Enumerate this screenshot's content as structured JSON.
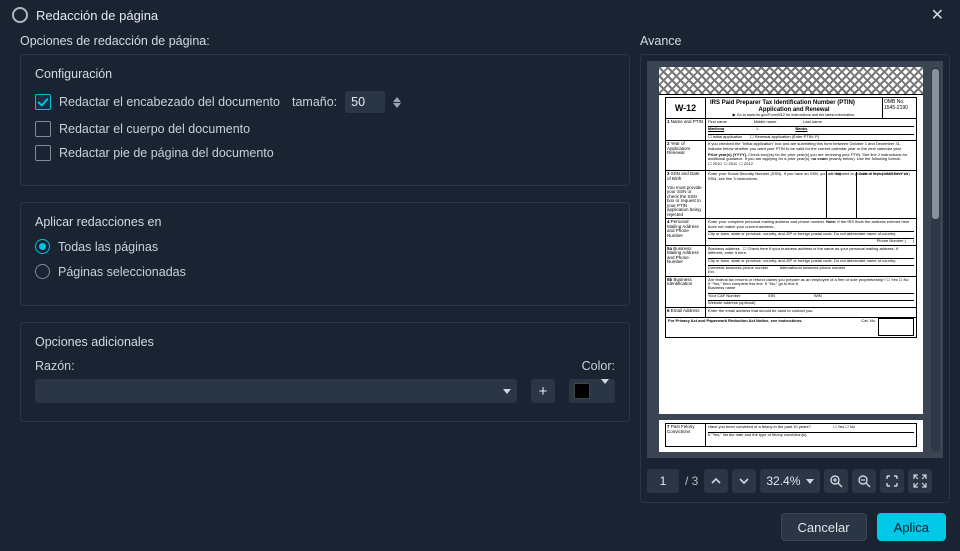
{
  "titlebar": {
    "title": "Redacción de página"
  },
  "left": {
    "heading": "Opciones de redacción de página:",
    "config": {
      "title": "Configuración",
      "header_redact_label": "Redactar el encabezado del documento",
      "size_label": "tamaño:",
      "size_value": "50",
      "body_redact_label": "Redactar el cuerpo del documento",
      "footer_redact_label": "Redactar pie de página del documento"
    },
    "apply": {
      "title": "Aplicar redacciones en",
      "all_pages": "Todas las páginas",
      "selected_pages": "Páginas seleccionadas"
    },
    "additional": {
      "title": "Opciones adicionales",
      "reason_label": "Razón:",
      "color_label": "Color:",
      "color_value": "#000000"
    }
  },
  "right": {
    "heading": "Avance",
    "doc": {
      "form_id": "W-12",
      "title_line1": "IRS Paid Preparer Tax Identification Number (PTIN)",
      "title_line2": "Application and Renewal",
      "omb": "OMB No. 1545-2190"
    },
    "toolbar": {
      "page_current": "1",
      "page_total": "/ 3",
      "zoom": "32.4%"
    }
  },
  "footer": {
    "cancel": "Cancelar",
    "apply": "Aplica"
  }
}
